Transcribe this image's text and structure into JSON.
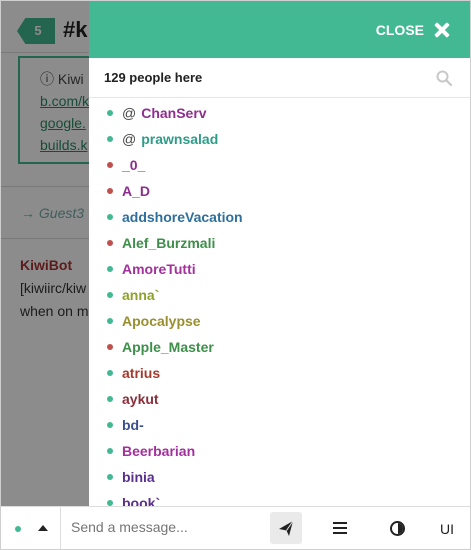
{
  "channel": {
    "count": "5",
    "name": "#ki"
  },
  "background": {
    "info_text": "ⓘ Kiwi",
    "info_link1": "b.com/k",
    "info_link2": "google.",
    "info_link3": "builds.k",
    "join_text": "→ Guest3",
    "bot_nick": "KiwiBot",
    "bot_line1": "[kiwiirc/kiw",
    "bot_line2": "when on m"
  },
  "panel": {
    "close_label": "CLOSE",
    "people_count": "129 people here",
    "nicks": [
      {
        "prefix": "@",
        "name": "ChanServ",
        "color": "#8e2e8e",
        "status": "#42b992"
      },
      {
        "prefix": "@",
        "name": "prawnsalad",
        "color": "#2f9c88",
        "status": "#42b992"
      },
      {
        "prefix": "",
        "name": "_0_",
        "color": "#8e2e8e",
        "status": "#c0504d"
      },
      {
        "prefix": "",
        "name": "A_D",
        "color": "#8e2e8e",
        "status": "#c0504d"
      },
      {
        "prefix": "",
        "name": "addshoreVacation",
        "color": "#2e6f9c",
        "status": "#42b992"
      },
      {
        "prefix": "",
        "name": "Alef_Burzmali",
        "color": "#3d8f4a",
        "status": "#c0504d"
      },
      {
        "prefix": "",
        "name": "AmoreTutti",
        "color": "#a3309c",
        "status": "#42b992"
      },
      {
        "prefix": "",
        "name": "anna`",
        "color": "#8fa02e",
        "status": "#42b992"
      },
      {
        "prefix": "",
        "name": "Apocalypse",
        "color": "#9a8f2e",
        "status": "#42b992"
      },
      {
        "prefix": "",
        "name": "Apple_Master",
        "color": "#3d8f4a",
        "status": "#c0504d"
      },
      {
        "prefix": "",
        "name": "atrius",
        "color": "#a33a2e",
        "status": "#42b992"
      },
      {
        "prefix": "",
        "name": "aykut",
        "color": "#8a2e3a",
        "status": "#42b992"
      },
      {
        "prefix": "",
        "name": "bd-",
        "color": "#3a4f8f",
        "status": "#42b992"
      },
      {
        "prefix": "",
        "name": "Beerbarian",
        "color": "#a3309c",
        "status": "#42b992"
      },
      {
        "prefix": "",
        "name": "binia",
        "color": "#5a2e8f",
        "status": "#42b992"
      },
      {
        "prefix": "",
        "name": "book`",
        "color": "#5a2e8f",
        "status": "#42b992"
      }
    ]
  },
  "footer": {
    "message_placeholder": "Send a message...",
    "ui_label": "UI"
  },
  "colors": {
    "accent": "#42b992"
  },
  "icons": [
    "search-icon",
    "close-icon",
    "send-icon",
    "menu-icon",
    "theme-icon",
    "caret-up-icon"
  ]
}
